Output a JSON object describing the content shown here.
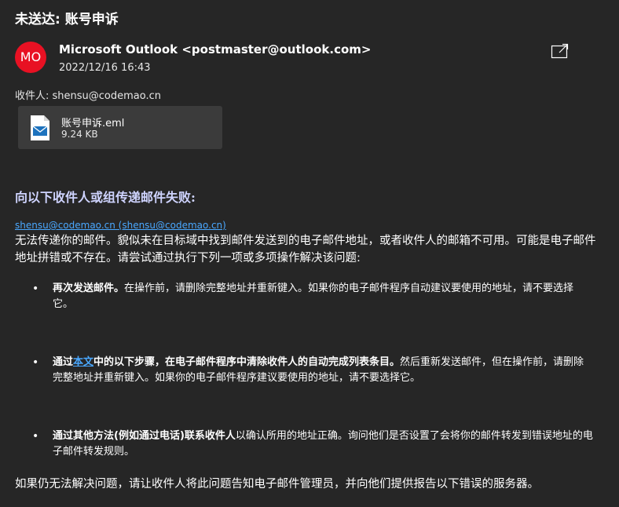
{
  "header": {
    "subject": "未送达: 账号申诉",
    "avatar_initials": "MO",
    "sender": "Microsoft Outlook <postmaster@outlook.com>",
    "date": "2022/12/16 16:43",
    "recipients": "收件人: shensu@codemao.cn"
  },
  "attachment": {
    "name": "账号申诉.eml",
    "size": "9.24 KB"
  },
  "body": {
    "heading": "向以下收件人或组传递邮件失败:",
    "recipient_link": "shensu@codemao.cn (shensu@codemao.cn)",
    "paragraph1": "无法传递你的邮件。貌似未在目标域中找到邮件发送到的电子邮件地址，或者收件人的邮箱不可用。可能是电子邮件地址拼错或不存在。请尝试通过执行下列一项或多项操作解决该问题:",
    "bullets": [
      {
        "bold": "再次发送邮件。",
        "text": "在操作前，请删除完整地址并重新键入。如果你的电子邮件程序自动建议要使用的地址，请不要选择它。"
      },
      {
        "bold_before": "通过",
        "link": "本文",
        "bold_after": "中的以下步骤，在电子邮件程序中清除收件人的自动完成列表条目。",
        "text": "然后重新发送邮件，但在操作前，请删除完整地址并重新键入。如果你的电子邮件程序建议要使用的地址，请不要选择它。"
      },
      {
        "bold": "通过其他方法(例如通过电话)联系收件人",
        "text": "以确认所用的地址正确。询问他们是否设置了会将你的邮件转发到错误地址的电子邮件转发规则。"
      }
    ],
    "paragraph2": "如果仍无法解决问题，请让收件人将此问题告知电子邮件管理员，并向他们提供报告以下错误的服务器。"
  },
  "icons": {
    "popout": "popout-icon",
    "attachment": "email-file-icon"
  },
  "colors": {
    "background": "#262626",
    "avatar": "#e81123",
    "link": "#4aa8ff",
    "attachment_bg": "#3b3b3b"
  }
}
